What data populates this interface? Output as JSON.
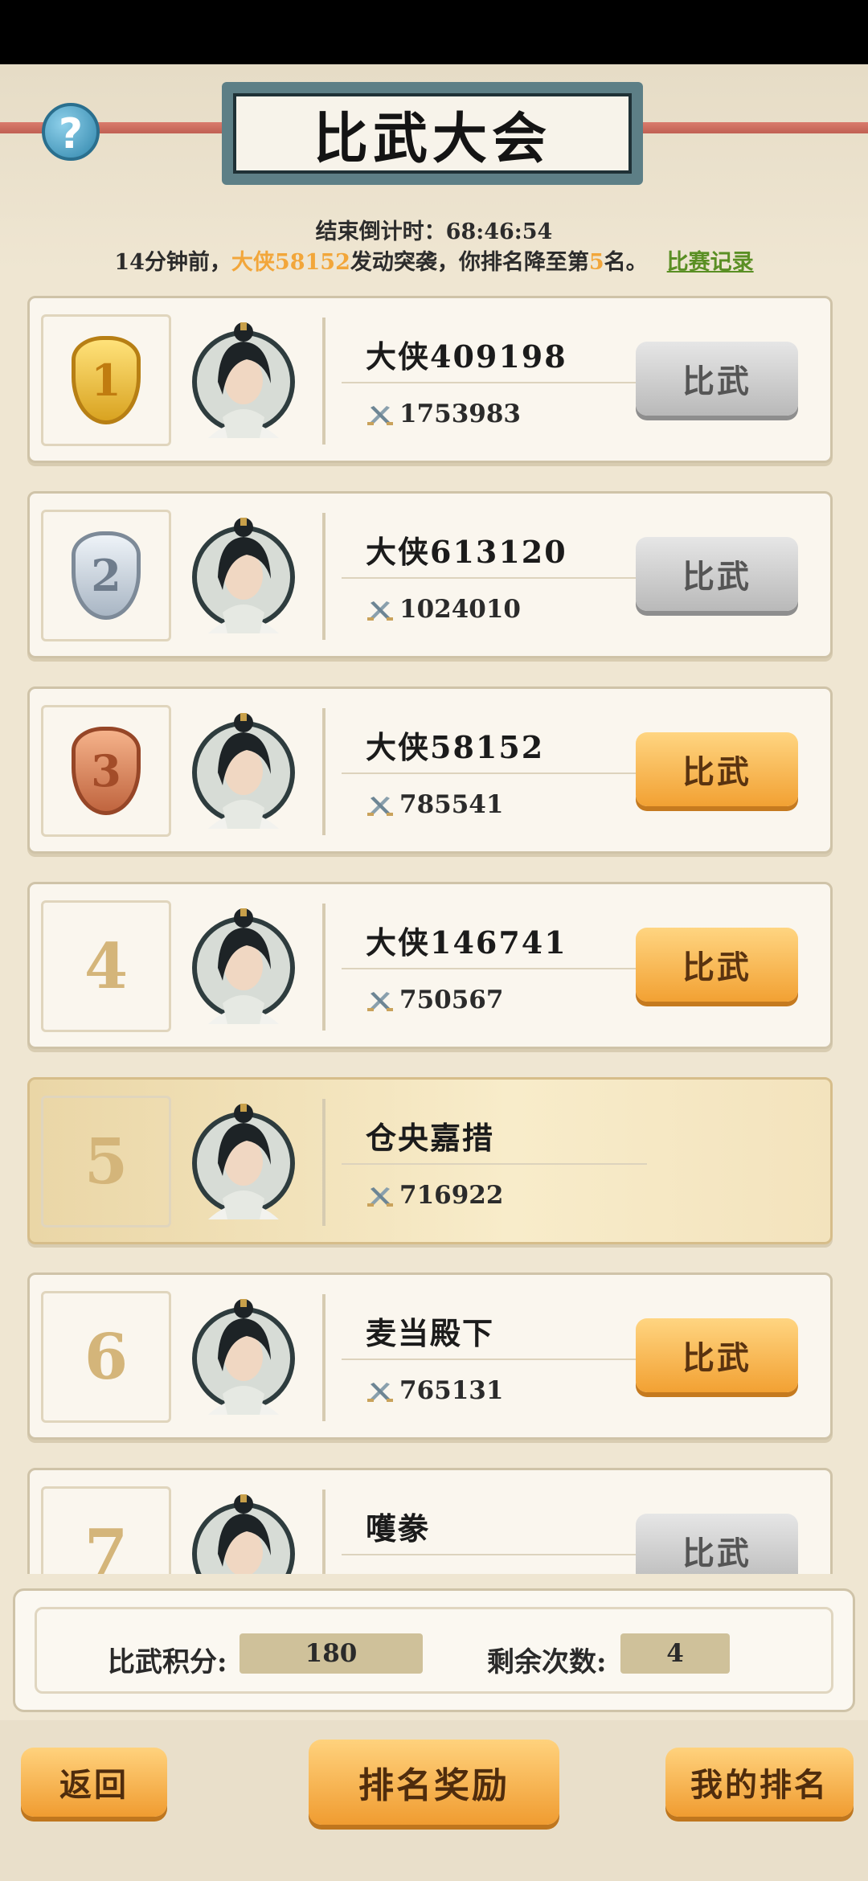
{
  "header": {
    "title": "比武大会",
    "help_label": "?",
    "countdown": "结束倒计时：68:46:54",
    "notice": {
      "prefix": "14分钟前，",
      "attacker": "大侠58152",
      "middle": "发动突袭，你排名降至第",
      "rank": "5",
      "suffix": "名。",
      "record_link": "比赛记录"
    }
  },
  "ranking": [
    {
      "rank": "1",
      "name": "大侠409198",
      "power": "1753983",
      "button": "比武",
      "button_style": "grey",
      "medal": "gold"
    },
    {
      "rank": "2",
      "name": "大侠613120",
      "power": "1024010",
      "button": "比武",
      "button_style": "grey",
      "medal": "silver"
    },
    {
      "rank": "3",
      "name": "大侠58152",
      "power": "785541",
      "button": "比武",
      "button_style": "orange",
      "medal": "bronze"
    },
    {
      "rank": "4",
      "name": "大侠146741",
      "power": "750567",
      "button": "比武",
      "button_style": "orange",
      "medal": "none"
    },
    {
      "rank": "5",
      "name": "仓央嘉措",
      "power": "716922",
      "button": "",
      "button_style": "none",
      "medal": "none",
      "is_self": true
    },
    {
      "rank": "6",
      "name": "麦当殿下",
      "power": "765131",
      "button": "比武",
      "button_style": "orange",
      "medal": "none"
    },
    {
      "rank": "7",
      "name": "嚄豢",
      "power": "",
      "button": "比武",
      "button_style": "grey",
      "medal": "none"
    }
  ],
  "stats": {
    "score_label": "比武积分:",
    "score_value": "180",
    "remaining_label": "剩余次数:",
    "remaining_value": "4"
  },
  "footer": {
    "back": "返回",
    "rank_reward": "排名奖励",
    "my_rank": "我的排名"
  },
  "colors": {
    "accent_orange": "#f2a133",
    "highlight_name": "#f2a63a",
    "link_green": "#5a8f24"
  }
}
